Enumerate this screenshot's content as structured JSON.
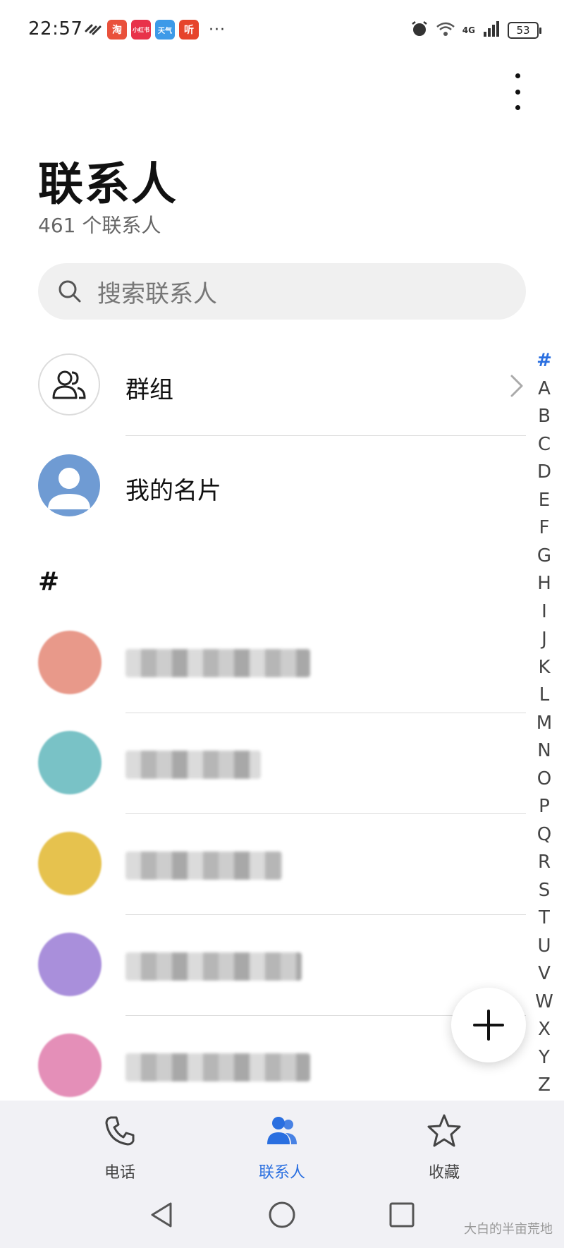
{
  "status_bar": {
    "time": "22:57",
    "battery": "53",
    "network": "4G",
    "apps": [
      "淘",
      "小红书",
      "天气",
      "听"
    ]
  },
  "header": {
    "title": "联系人",
    "count_text": "461 个联系人"
  },
  "search": {
    "placeholder": "搜索联系人"
  },
  "list": {
    "groups_label": "群组",
    "my_card_label": "我的名片",
    "section_label": "#",
    "contacts": [
      {
        "avatar_color": "#e8998a"
      },
      {
        "avatar_color": "#79c2c6"
      },
      {
        "avatar_color": "#e6c24e"
      },
      {
        "avatar_color": "#a98fdb"
      },
      {
        "avatar_color": "#e48fb8"
      }
    ]
  },
  "alphabet_index": [
    "#",
    "A",
    "B",
    "C",
    "D",
    "E",
    "F",
    "G",
    "H",
    "I",
    "J",
    "K",
    "L",
    "M",
    "N",
    "O",
    "P",
    "Q",
    "R",
    "S",
    "T",
    "U",
    "V",
    "W",
    "X",
    "Y",
    "Z"
  ],
  "bottom_nav": {
    "phone": "电话",
    "contacts": "联系人",
    "favorites": "收藏"
  },
  "colors": {
    "accent": "#2a6fe0",
    "search_bg": "#f0f0f0",
    "nav_bg": "#f1f1f5"
  },
  "watermark": "大白的半亩荒地"
}
